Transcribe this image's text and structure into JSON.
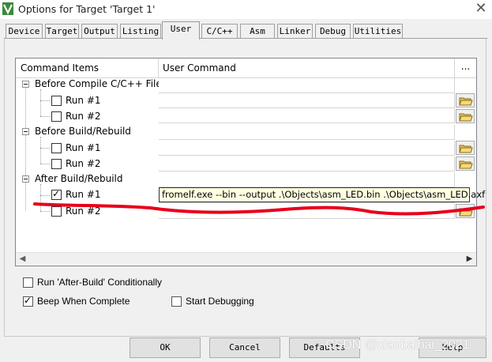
{
  "window": {
    "title": "Options for Target 'Target 1'",
    "close_glyph": "✕"
  },
  "tabs": [
    {
      "label": "Device"
    },
    {
      "label": "Target"
    },
    {
      "label": "Output"
    },
    {
      "label": "Listing"
    },
    {
      "label": "User",
      "active": true
    },
    {
      "label": "C/C++"
    },
    {
      "label": "Asm"
    },
    {
      "label": "Linker"
    },
    {
      "label": "Debug"
    },
    {
      "label": "Utilities"
    }
  ],
  "grid": {
    "headers": {
      "command_items": "Command Items",
      "user_command": "User Command",
      "browse": "..."
    },
    "groups": [
      {
        "label": "Before Compile C/C++ File",
        "items": [
          {
            "label": "Run #1",
            "checked": false,
            "command": ""
          },
          {
            "label": "Run #2",
            "checked": false,
            "command": ""
          }
        ]
      },
      {
        "label": "Before Build/Rebuild",
        "items": [
          {
            "label": "Run #1",
            "checked": false,
            "command": ""
          },
          {
            "label": "Run #2",
            "checked": false,
            "command": ""
          }
        ]
      },
      {
        "label": "After Build/Rebuild",
        "items": [
          {
            "label": "Run #1",
            "checked": true,
            "command": "fromelf.exe --bin --output .\\Objects\\asm_LED.bin .\\Objects\\asm_LED.axf"
          },
          {
            "label": "Run #2",
            "checked": false,
            "command": ""
          }
        ]
      }
    ]
  },
  "options": {
    "run_after_build": {
      "label": "Run 'After-Build' Conditionally",
      "checked": false
    },
    "beep": {
      "label": "Beep When Complete",
      "checked": true
    },
    "start_debugging": {
      "label": "Start Debugging",
      "checked": false
    }
  },
  "buttons": {
    "ok": "OK",
    "cancel": "Cancel",
    "defaults": "Defaults",
    "help": "Help"
  },
  "watermark": "CSDN @xiaobaibai_2021",
  "annotation_color": "#e8001a"
}
